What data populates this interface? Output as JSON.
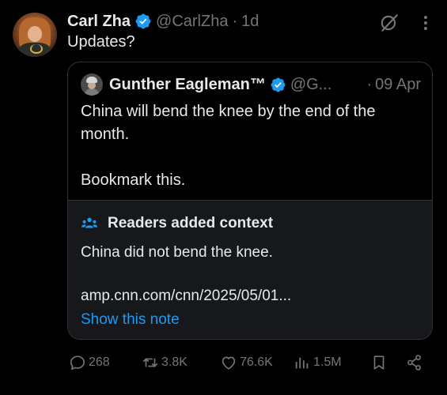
{
  "tweet": {
    "author_name": "Carl Zha",
    "handle": "@CarlZha",
    "separator": "·",
    "time": "1d",
    "text": "Updates?"
  },
  "quote": {
    "author_name": "Gunther Eagleman™",
    "handle": "@G...",
    "separator": "·",
    "time": "09 Apr",
    "line1": "China will bend the knee by the end of the month.",
    "line2": "Bookmark this."
  },
  "community_note": {
    "title": "Readers added context",
    "text": "China did not bend the knee.",
    "link": "amp.cnn.com/cnn/2025/05/01...",
    "show_label": "Show this note"
  },
  "actions": {
    "replies": "268",
    "reposts": "3.8K",
    "likes": "76.6K",
    "views": "1.5M"
  },
  "icons": {
    "verified": "verified-badge-icon",
    "grok": "grok-icon",
    "more": "more-icon",
    "people": "people-icon",
    "reply": "reply-icon",
    "repost": "repost-icon",
    "like": "heart-icon",
    "views": "views-chart-icon",
    "bookmark": "bookmark-icon",
    "share": "share-icon"
  },
  "colors": {
    "background": "#000000",
    "text": "#e7e9ea",
    "muted": "#71767b",
    "accent": "#1d9bf0",
    "note_background": "#16181c"
  }
}
